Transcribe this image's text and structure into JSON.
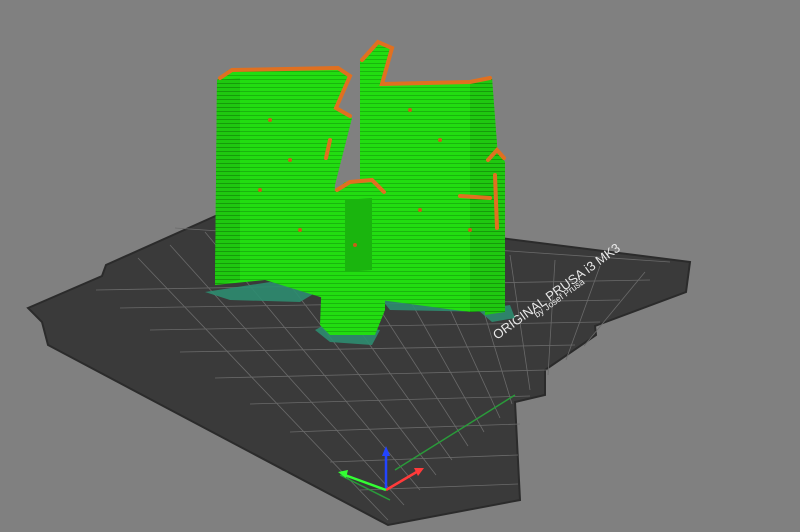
{
  "bed": {
    "brand_text": "ORIGINAL PRUSA i3 MK3",
    "by_text": "by Josef Prusa"
  },
  "colors": {
    "background": "#808080",
    "bed": "#3a3a3a",
    "bed_edge": "#2b2b2b",
    "grid": "#6a6a6a",
    "perimeter": "#22dd11",
    "perimeter_dark": "#18a80c",
    "overhang": "#e07020",
    "support": "#2d8c70",
    "axis_x": "#ff3a3a",
    "axis_y": "#33ff33",
    "axis_z": "#2244ff"
  },
  "icons": [
    "axis-gizmo-icon"
  ]
}
